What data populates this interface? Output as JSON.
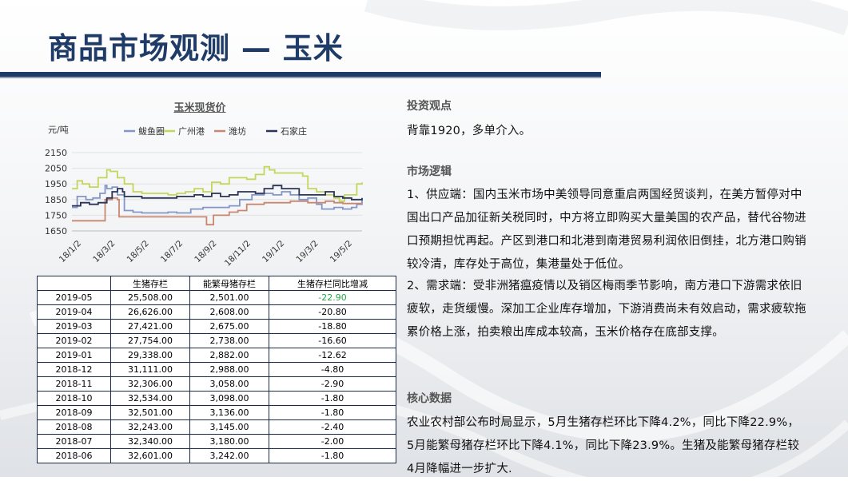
{
  "title": "商品市场观测 — 玉米",
  "colors": {
    "title": "#1f3b67",
    "series_bayuquan": "#8496c8",
    "series_guangzhou": "#c4d65a",
    "series_weifang": "#c88870",
    "series_shijiazhuang": "#2a3358",
    "positive_green": "#22a84a"
  },
  "chart_data": {
    "type": "line",
    "title": "玉米现货价",
    "ylabel": "元/吨",
    "ylim": [
      1650,
      2150
    ],
    "yticks": [
      1650,
      1750,
      1850,
      1950,
      2050,
      2150
    ],
    "xticks": [
      "18/1/2",
      "18/3/2",
      "18/5/2",
      "18/7/2",
      "18/9/2",
      "18/11/2",
      "19/1/2",
      "19/3/2",
      "19/5/2"
    ],
    "legend_position": "top",
    "grid": true,
    "series": [
      {
        "name": "鲅鱼圈",
        "color": "#8496c8",
        "x": [
          0,
          0.3,
          0.8,
          1.2,
          1.6,
          1.9,
          2.0,
          2.3,
          2.6,
          3.0,
          3.5,
          4.0,
          5.0,
          5.5,
          6.0,
          6.8,
          7.5,
          8.0,
          8.5,
          9.0,
          9.6,
          10.3,
          11.0,
          11.5,
          12.0,
          12.5,
          13.0,
          13.5,
          14.0,
          14.3,
          15.0,
          15.5,
          16.0,
          16.3,
          16.6
        ],
        "values": [
          1800,
          1870,
          1850,
          1860,
          1890,
          1940,
          1920,
          1930,
          1880,
          1780,
          1770,
          1765,
          1765,
          1770,
          1765,
          1790,
          1800,
          1800,
          1800,
          1810,
          1850,
          1880,
          1890,
          1880,
          1900,
          1880,
          1850,
          1860,
          1820,
          1790,
          1800,
          1790,
          1800,
          1820,
          1850
        ]
      },
      {
        "name": "广州港",
        "color": "#c4d65a",
        "x": [
          0,
          0.3,
          0.6,
          1.0,
          1.5,
          2.0,
          2.2,
          2.6,
          3.0,
          3.5,
          4.0,
          5.0,
          5.5,
          6.0,
          6.5,
          7.0,
          7.5,
          8.0,
          8.5,
          9.0,
          9.5,
          10.0,
          10.5,
          11.0,
          11.3,
          11.6,
          12.0,
          12.5,
          13.0,
          13.2,
          13.5,
          14.0,
          14.5,
          15.0,
          15.3,
          15.6,
          16.0,
          16.3,
          16.6
        ],
        "values": [
          1920,
          1970,
          1950,
          1930,
          1990,
          2040,
          2030,
          1990,
          1950,
          1900,
          1890,
          1890,
          1880,
          1890,
          1900,
          1920,
          1900,
          1960,
          1950,
          1990,
          1990,
          1980,
          2010,
          2060,
          2040,
          2020,
          2020,
          2020,
          2020,
          2000,
          1920,
          1900,
          1880,
          1860,
          1840,
          1880,
          1880,
          1950,
          1960
        ]
      },
      {
        "name": "潍坊",
        "color": "#c88870",
        "x": [
          0,
          1.0,
          1.8,
          1.9,
          2.3,
          2.6,
          2.7,
          3.5,
          4.5,
          5.5,
          6.5,
          7.0,
          7.6,
          7.7,
          8.0,
          8.1,
          8.5,
          9.0,
          9.5,
          10.0,
          10.5,
          11.0,
          11.5,
          12.0,
          12.5,
          13.0,
          13.5,
          14.0,
          14.5,
          15.0,
          15.5,
          16.0,
          16.6
        ],
        "values": [
          1715,
          1715,
          1715,
          1850,
          1860,
          1850,
          1740,
          1740,
          1740,
          1740,
          1740,
          1740,
          1740,
          1690,
          1690,
          1750,
          1750,
          1770,
          1780,
          1820,
          1820,
          1830,
          1830,
          1830,
          1840,
          1840,
          1830,
          1830,
          1840,
          1830,
          1825,
          1825,
          1825
        ]
      },
      {
        "name": "石家庄",
        "color": "#2a3358",
        "x": [
          0,
          0.5,
          1.0,
          1.5,
          2.0,
          2.3,
          2.6,
          2.9,
          3.0,
          4.0,
          5.0,
          6.0,
          7.0,
          7.5,
          8.0,
          8.5,
          9.0,
          9.5,
          10.0,
          10.5,
          11.0,
          11.5,
          12.0,
          12.5,
          13.0,
          13.5,
          14.0,
          14.5,
          15.0,
          15.5,
          16.0,
          16.6
        ],
        "values": [
          1810,
          1830,
          1820,
          1830,
          1860,
          1900,
          1920,
          1900,
          1870,
          1860,
          1860,
          1870,
          1880,
          1870,
          1890,
          1870,
          1880,
          1900,
          1900,
          1890,
          1920,
          1940,
          1920,
          1920,
          1880,
          1880,
          1880,
          1900,
          1870,
          1860,
          1850,
          1860
        ]
      }
    ]
  },
  "table": {
    "headers": [
      "",
      "生猪存栏",
      "能繁母猪存栏",
      "生猪存栏同比增减"
    ],
    "rows": [
      [
        "2019-05",
        "25,508.00",
        "2,501.00",
        "-22.90"
      ],
      [
        "2019-04",
        "26,626.00",
        "2,608.00",
        "-20.80"
      ],
      [
        "2019-03",
        "27,421.00",
        "2,675.00",
        "-18.80"
      ],
      [
        "2019-02",
        "27,754.00",
        "2,738.00",
        "-16.60"
      ],
      [
        "2019-01",
        "29,338.00",
        "2,882.00",
        "-12.62"
      ],
      [
        "2018-12",
        "31,111.00",
        "2,988.00",
        "-4.80"
      ],
      [
        "2018-11",
        "32,306.00",
        "3,058.00",
        "-2.90"
      ],
      [
        "2018-10",
        "32,534.00",
        "3,098.00",
        "-1.80"
      ],
      [
        "2018-09",
        "32,501.00",
        "3,136.00",
        "-1.80"
      ],
      [
        "2018-08",
        "32,243.00",
        "3,145.00",
        "-2.40"
      ],
      [
        "2018-07",
        "32,340.00",
        "3,180.00",
        "-2.00"
      ],
      [
        "2018-06",
        "32,601.00",
        "3,242.00",
        "-1.80"
      ]
    ]
  },
  "sections": {
    "view_heading": "投资观点",
    "view_text": "背靠1920，多单介入。",
    "logic_heading": "市场逻辑",
    "logic_p1": "1、供应端：国内玉米市场中美领导同意重启两国经贸谈判，在美方暂停对中国出口产品加征新关税同时，中方将立即购买大量美国的农产品，替代谷物进口预期担忧再起。产区到港口和北港到南港贸易利润依旧倒挂，北方港口购销较冷清，库存处于高位，集港量处于低位。",
    "logic_p2": "2、需求端：受非洲猪瘟疫情以及销区梅雨季节影响，南方港口下游需求依旧疲软，走货缓慢。深加工企业库存增加，下游消费尚未有效启动，需求疲软拖累价格上涨，拍卖粮出库成本较高，玉米价格存在底部支撑。",
    "data_heading": "核心数据",
    "data_text": "农业农村部公布时局显示，5月生猪存栏环比下降4.2%，同比下降22.9%，5月能繁母猪存栏环比下降4.1%，同比下降23.9%。生猪及能繁母猪存栏较4月降幅进一步扩大."
  }
}
